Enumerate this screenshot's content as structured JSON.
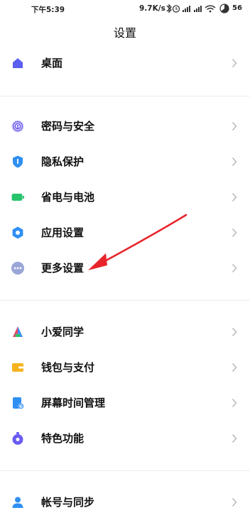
{
  "status_bar": {
    "time": "下午5:39",
    "net_rate": "9.7K/s",
    "battery_pct": "56"
  },
  "header": {
    "title": "设置"
  },
  "sections": [
    {
      "items": [
        {
          "label": "桌面",
          "icon": "home-icon",
          "color": "#5b5ef0"
        }
      ]
    },
    {
      "items": [
        {
          "label": "密码与安全",
          "icon": "fingerprint-icon",
          "color": "#6a5cf0"
        },
        {
          "label": "隐私保护",
          "icon": "shield-icon",
          "color": "#2f8ff3"
        },
        {
          "label": "省电与电池",
          "icon": "battery-icon",
          "color": "#27c46c"
        },
        {
          "label": "应用设置",
          "icon": "gear-icon",
          "color": "#2f8ff3"
        },
        {
          "label": "更多设置",
          "icon": "more-dots-icon",
          "color": "#9aa6d8"
        }
      ]
    },
    {
      "items": [
        {
          "label": "小爱同学",
          "icon": "xiaoai-icon",
          "color": "#e84b6b"
        },
        {
          "label": "钱包与支付",
          "icon": "wallet-icon",
          "color": "#f5b21d"
        },
        {
          "label": "屏幕时间管理",
          "icon": "screen-time-icon",
          "color": "#2f8ff3"
        },
        {
          "label": "特色功能",
          "icon": "feature-icon",
          "color": "#6a5cf0"
        }
      ]
    },
    {
      "items": [
        {
          "label": "帐号与同步",
          "icon": "account-icon",
          "color": "#2f8ff3"
        }
      ]
    }
  ],
  "colors": {
    "arrow": "#e8242b",
    "chevron": "#b5b5b5",
    "divider": "#ececec"
  }
}
